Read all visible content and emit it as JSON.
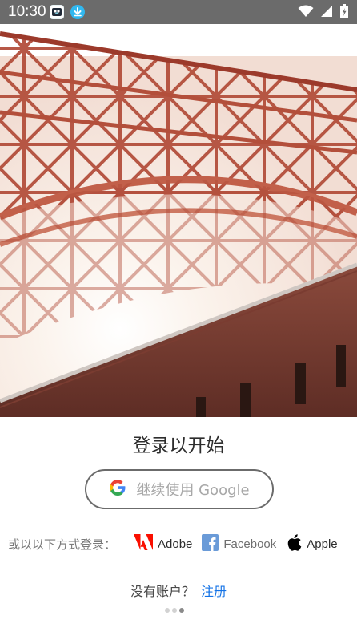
{
  "status_bar": {
    "time": "10:30",
    "left_icons": [
      "wallpaper-app-icon",
      "download-icon"
    ],
    "right_icons": [
      "wifi-icon",
      "signal-icon",
      "battery-icon"
    ]
  },
  "hero": {
    "image": "bridge-photo"
  },
  "title": "登录以开始",
  "google_button": {
    "label": "继续使用 Google",
    "icon": "google-g-icon"
  },
  "alt_login": {
    "label": "或以以下方式登录：",
    "providers": [
      {
        "name": "Adobe",
        "icon": "adobe-icon"
      },
      {
        "name": "Facebook",
        "icon": "facebook-icon"
      },
      {
        "name": "Apple",
        "icon": "apple-icon"
      }
    ]
  },
  "signup": {
    "prompt": "没有账户？",
    "link": "注册"
  },
  "pagination": {
    "total": 3,
    "active_index": 2
  },
  "colors": {
    "link": "#1473e6",
    "adobe_red": "#fa0f00",
    "facebook_blue": "#6a9bd8",
    "status_bar": "#6b6b6b"
  }
}
